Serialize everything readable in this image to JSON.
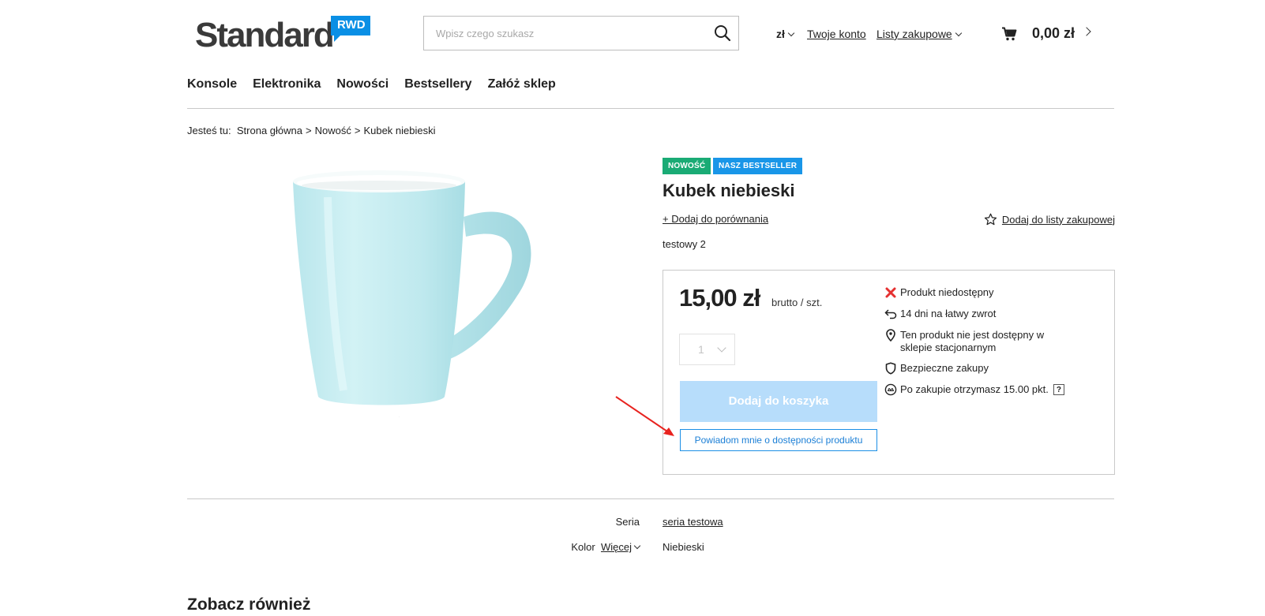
{
  "header": {
    "logo_text": "Standard",
    "logo_badge": "RWD",
    "search_placeholder": "Wpisz czego szukasz",
    "currency": "zł",
    "account": "Twoje konto",
    "shopping_lists": "Listy zakupowe",
    "cart_total": "0,00 zł"
  },
  "nav": {
    "items": [
      "Konsole",
      "Elektronika",
      "Nowości",
      "Bestsellery",
      "Załóż sklep"
    ]
  },
  "breadcrumb": {
    "prefix": "Jesteś tu:",
    "items": [
      "Strona główna",
      "Nowość",
      "Kubek niebieski"
    ]
  },
  "product": {
    "badges": {
      "new": "NOWOŚĆ",
      "bestseller": "NASZ BESTSELLER"
    },
    "title": "Kubek niebieski",
    "compare": "+ Dodaj do porównania",
    "wishlist": "Dodaj do listy zakupowej",
    "description": "testowy 2",
    "price": "15,00 zł",
    "price_unit": "brutto / szt.",
    "quantity": "1",
    "add_to_cart": "Dodaj do koszyka",
    "notify": "Powiadom mnie o dostępności produktu",
    "features": [
      {
        "icon": "x-icon",
        "text": "Produkt niedostępny"
      },
      {
        "icon": "return-icon",
        "text": "14 dni na łatwy zwrot"
      },
      {
        "icon": "location-pin-icon",
        "text": "Ten produkt nie jest dostępny w sklepie stacjonarnym"
      },
      {
        "icon": "shield-icon",
        "text": "Bezpieczne zakupy"
      },
      {
        "icon": "points-icon",
        "text": "Po zakupie otrzymasz 15.00 pkt."
      }
    ],
    "help_mark": "?"
  },
  "specs": {
    "series_label": "Seria",
    "series_value": "seria testowa",
    "color_label": "Kolor",
    "color_more": "Więcej",
    "color_value": "Niebieski"
  },
  "see_also": "Zobacz również",
  "colors": {
    "accent": "#1996e8",
    "new_badge": "#1aab75",
    "cart_button_disabled": "#b7ddfb",
    "mug": "#c8ecf0",
    "annotation_arrow": "#e8231f"
  }
}
